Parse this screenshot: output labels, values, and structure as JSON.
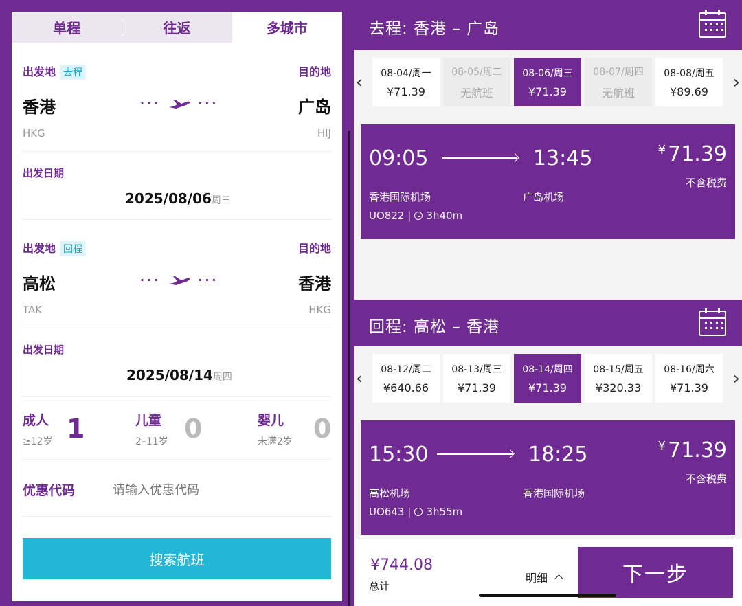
{
  "booking_form": {
    "tabs": [
      "单程",
      "往返",
      "多城市"
    ],
    "active_tab": 2,
    "leg1": {
      "origin_label": "出发地",
      "badge": "去程",
      "dest_label": "目的地",
      "origin_city": "香港",
      "origin_code": "HKG",
      "dest_city": "广岛",
      "dest_code": "HIJ",
      "date_label": "出发日期",
      "date": "2025/08/06",
      "weekday": "周三"
    },
    "leg2": {
      "origin_label": "出发地",
      "badge": "回程",
      "dest_label": "目的地",
      "origin_city": "高松",
      "origin_code": "TAK",
      "dest_city": "香港",
      "dest_code": "HKG",
      "date_label": "出发日期",
      "date": "2025/08/14",
      "weekday": "周四"
    },
    "passengers": {
      "adult_label": "成人",
      "adult_sub": "≥12岁",
      "adult_count": "1",
      "child_label": "儿童",
      "child_sub": "2–11岁",
      "child_count": "0",
      "infant_label": "婴儿",
      "infant_sub": "未满2岁",
      "infant_count": "0"
    },
    "promo_label": "优惠代码",
    "promo_placeholder": "请输入优惠代码",
    "search_button": "搜索航班"
  },
  "outbound": {
    "title": "去程:  香港 – 广岛",
    "dates": [
      {
        "date": "08-04/周一",
        "price": "¥71.39",
        "state": "normal"
      },
      {
        "date": "08-05/周二",
        "price": "无航班",
        "state": "disabled"
      },
      {
        "date": "08-06/周三",
        "price": "¥71.39",
        "state": "selected"
      },
      {
        "date": "08-07/周四",
        "price": "无航班",
        "state": "disabled"
      },
      {
        "date": "08-08/周五",
        "price": "¥89.69",
        "state": "normal"
      }
    ],
    "flight": {
      "dep_time": "09:05",
      "arr_time": "13:45",
      "price_currency": "¥",
      "price_value": "71.39",
      "tax_note": "不含税费",
      "dep_airport": "香港国际机场",
      "arr_airport": "广岛机场",
      "flight_no": "UO822",
      "duration": "3h40m"
    }
  },
  "return": {
    "title": "回程:  高松 – 香港",
    "dates": [
      {
        "date": "08-12/周二",
        "price": "¥640.66",
        "state": "normal"
      },
      {
        "date": "08-13/周三",
        "price": "¥71.39",
        "state": "normal"
      },
      {
        "date": "08-14/周四",
        "price": "¥71.39",
        "state": "selected"
      },
      {
        "date": "08-15/周五",
        "price": "¥320.33",
        "state": "normal"
      },
      {
        "date": "08-16/周六",
        "price": "¥71.39",
        "state": "normal"
      }
    ],
    "flight": {
      "dep_time": "15:30",
      "arr_time": "18:25",
      "price_currency": "¥",
      "price_value": "71.39",
      "tax_note": "不含税费",
      "dep_airport": "高松机场",
      "arr_airport": "香港国际机场",
      "flight_no": "UO643",
      "duration": "3h55m"
    }
  },
  "footer": {
    "total_price": "¥744.08",
    "total_label": "总计",
    "detail_label": "明细",
    "next_button": "下一步"
  },
  "colors": {
    "brand_purple": "#6f2b91",
    "search_cyan": "#22b7d7",
    "badge_bg": "#dff3f8"
  },
  "icons": [
    "plane-icon",
    "calendar-icon",
    "chevron-left-icon",
    "chevron-right-icon",
    "clock-icon",
    "chevron-up-icon"
  ]
}
